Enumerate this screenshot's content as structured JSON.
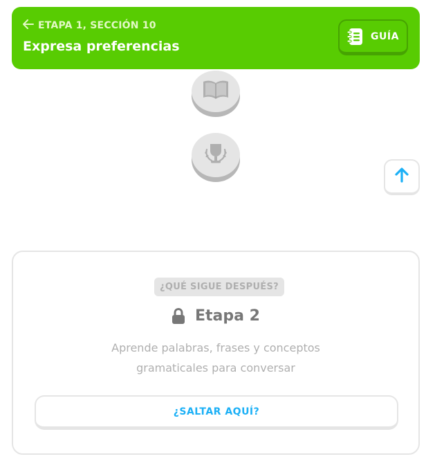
{
  "header": {
    "back_label": "ETAPA 1, SECCIÓN 10",
    "unit_title": "Expresa preferencias",
    "guide_label": "GUÍA",
    "background_color": "#58cc02",
    "back_icon": "arrow-left-icon",
    "guide_icon": "notebook-icon"
  },
  "path": {
    "nodes": [
      {
        "icon": "book-icon",
        "state": "locked"
      },
      {
        "icon": "trophy-icon",
        "state": "locked"
      }
    ],
    "scroll_up_icon": "arrow-up-icon"
  },
  "next_stage": {
    "badge": "¿QUÉ SIGUE DESPUÉS?",
    "title": "Etapa 2",
    "title_icon": "lock-icon",
    "description": "Aprende palabras, frases y conceptos gramaticales para conversar",
    "jump_label": "¿SALTAR AQUÍ?",
    "accent_color": "#1cb0f6"
  }
}
